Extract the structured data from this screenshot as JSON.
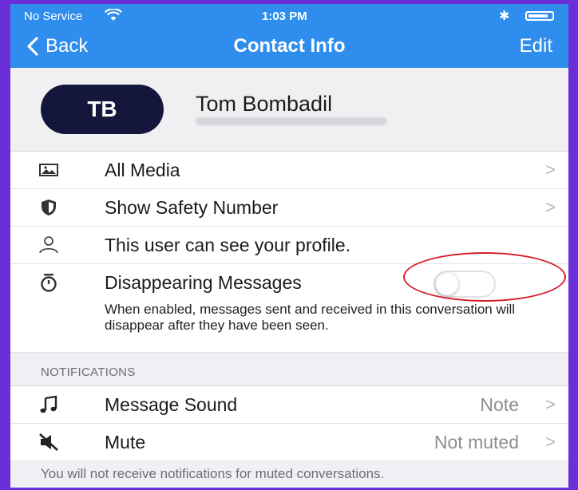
{
  "status_bar": {
    "carrier": "No Service",
    "time": "1:03 PM"
  },
  "nav": {
    "back_label": "Back",
    "title": "Contact Info",
    "edit_label": "Edit"
  },
  "profile": {
    "initials": "TB",
    "name": "Tom Bombadil",
    "avatar_color": "#15163b"
  },
  "rows": [
    {
      "label": "All Media",
      "icon": "photo-icon",
      "chevron": ">"
    },
    {
      "label": "Show Safety Number",
      "icon": "shield-icon",
      "chevron": ">"
    },
    {
      "label": "This user can see your profile.",
      "icon": "person-icon"
    },
    {
      "label": "Disappearing Messages",
      "icon": "timer-icon",
      "toggle_on": false,
      "description": "When enabled, messages sent and received in this conversation will disappear after they have been seen."
    }
  ],
  "notifications": {
    "header": "NOTIFICATIONS",
    "rows": [
      {
        "label": "Message Sound",
        "value": "Note",
        "icon": "music-note-icon",
        "chevron": ">"
      },
      {
        "label": "Mute",
        "value": "Not muted",
        "icon": "mute-speaker-icon",
        "chevron": ">"
      }
    ],
    "footer": "You will not receive notifications for muted conversations."
  },
  "colors": {
    "nav_background": "#2f8ded",
    "frame_background": "#6a2fd6",
    "highlight": "#d61f2c"
  }
}
